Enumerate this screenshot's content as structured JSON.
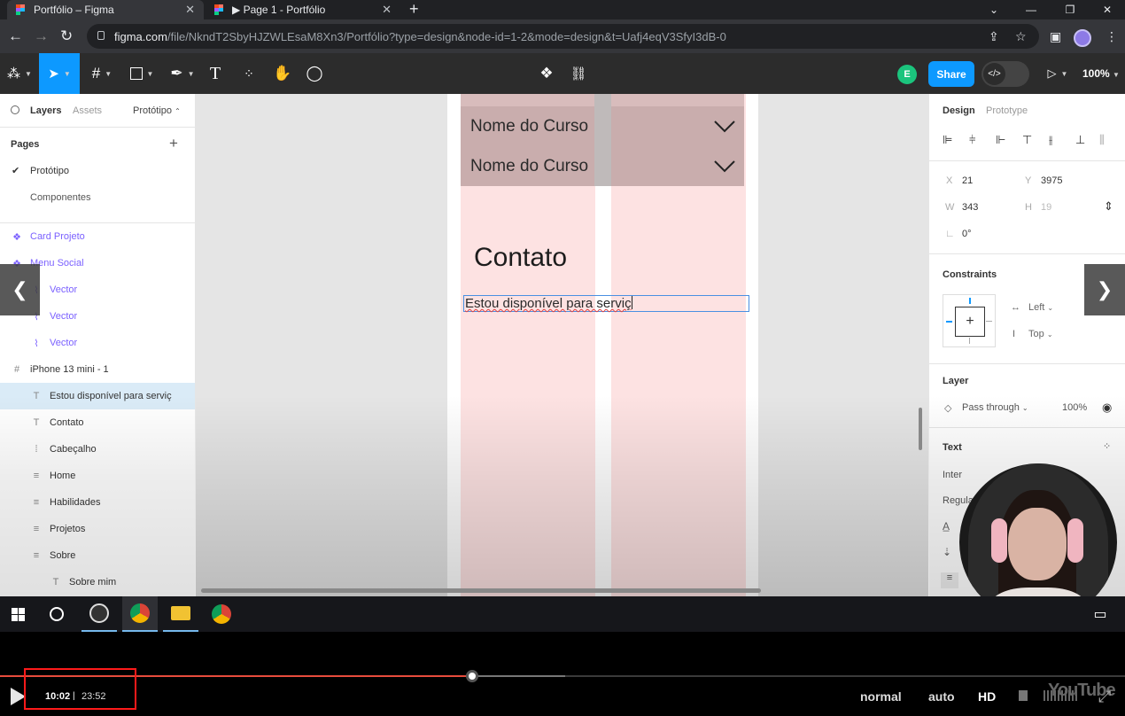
{
  "browser": {
    "tabs": [
      {
        "title": "Portfólio – Figma",
        "active": true
      },
      {
        "title": "▶ Page 1 - Portfólio",
        "active": false
      }
    ],
    "url_host": "figma.com",
    "url_path": "/file/NkndT2SbyHJZWLEsaM8Xn3/Portfólio?type=design&node-id=1-2&mode=design&t=Uafj4eqV3SfyI3dB-0"
  },
  "figma_toolbar": {
    "user_initial": "E",
    "share_label": "Share",
    "zoom": "100%"
  },
  "layers_panel": {
    "tabs": {
      "layers": "Layers",
      "assets": "Assets",
      "page_selector": "Protótipo"
    },
    "pages_heading": "Pages",
    "pages": [
      "Protótipo",
      "Componentes"
    ],
    "layers": [
      {
        "name": "Card Projeto",
        "icon": "component-icon",
        "indent": 0,
        "component": true
      },
      {
        "name": "Menu Social",
        "icon": "component-icon",
        "indent": 0,
        "component": true
      },
      {
        "name": "Vector",
        "icon": "vector-icon",
        "indent": 1,
        "component": true
      },
      {
        "name": "Vector",
        "icon": "vector-icon",
        "indent": 1,
        "component": true
      },
      {
        "name": "Vector",
        "icon": "vector-icon",
        "indent": 1,
        "component": true
      },
      {
        "name": "iPhone 13 mini - 1",
        "icon": "frame-icon",
        "indent": 0,
        "component": false
      },
      {
        "name": "Estou disponível para serviç",
        "icon": "text-icon",
        "indent": 1,
        "component": false,
        "selected": true
      },
      {
        "name": "Contato",
        "icon": "text-icon",
        "indent": 1,
        "component": false
      },
      {
        "name": "Cabeçalho",
        "icon": "grid-icon",
        "indent": 1,
        "component": false
      },
      {
        "name": "Home",
        "icon": "list-icon",
        "indent": 1,
        "component": false
      },
      {
        "name": "Habilidades",
        "icon": "list-icon",
        "indent": 1,
        "component": false
      },
      {
        "name": "Projetos",
        "icon": "list-icon",
        "indent": 1,
        "component": false
      },
      {
        "name": "Sobre",
        "icon": "list-icon",
        "indent": 1,
        "component": false
      },
      {
        "name": "Sobre mim",
        "icon": "text-icon",
        "indent": 2,
        "component": false
      }
    ]
  },
  "canvas": {
    "course_rows": [
      "Nome do Curso",
      "Nome do Curso"
    ],
    "heading": "Contato",
    "editing_text": "Estou disponível para serviç"
  },
  "design_panel": {
    "tabs": {
      "design": "Design",
      "prototype": "Prototype"
    },
    "x_label": "X",
    "x": "21",
    "y_label": "Y",
    "y": "3975",
    "w_label": "W",
    "w": "343",
    "h_label": "H",
    "h": "19",
    "rotation": "0°",
    "constraints_heading": "Constraints",
    "constraint_h": "Left",
    "constraint_v": "Top",
    "layer_heading": "Layer",
    "blend_mode": "Pass through",
    "opacity": "100%",
    "text_heading": "Text",
    "font_family": "Inter",
    "font_weight": "Regula"
  },
  "video_player": {
    "current_time": "10:02",
    "separator": "|",
    "total_time": "23:52",
    "progress": 0.42,
    "speed": "normal",
    "quality": "auto",
    "hd": "HD",
    "watermark": "YouTube"
  },
  "colors": {
    "figma_blue": "#0d99ff",
    "frame_pink": "#fde2e2",
    "course_block": "#c9adad",
    "highlight_red": "#ff1a1a"
  }
}
